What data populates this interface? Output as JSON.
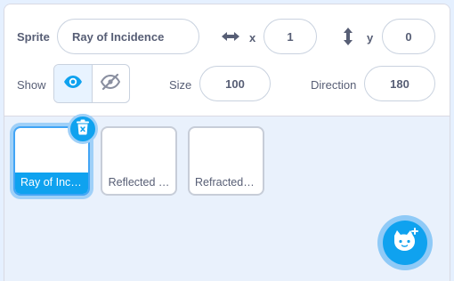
{
  "sprite_info": {
    "sprite_label": "Sprite",
    "sprite_name": "Ray of Incidence",
    "x_label": "x",
    "x_value": "1",
    "y_label": "y",
    "y_value": "0",
    "show_label": "Show",
    "size_label": "Size",
    "size_value": "100",
    "direction_label": "Direction",
    "direction_value": "180",
    "visible": true
  },
  "sprites": [
    {
      "label": "Ray of Inci…",
      "selected": true
    },
    {
      "label": "Reflected …",
      "selected": false
    },
    {
      "label": "Refracted …",
      "selected": false
    }
  ],
  "colors": {
    "accent": "#0fa2ef",
    "accent_glow": "#9fd0f8",
    "text": "#575e75",
    "background": "#e9f1fc"
  }
}
